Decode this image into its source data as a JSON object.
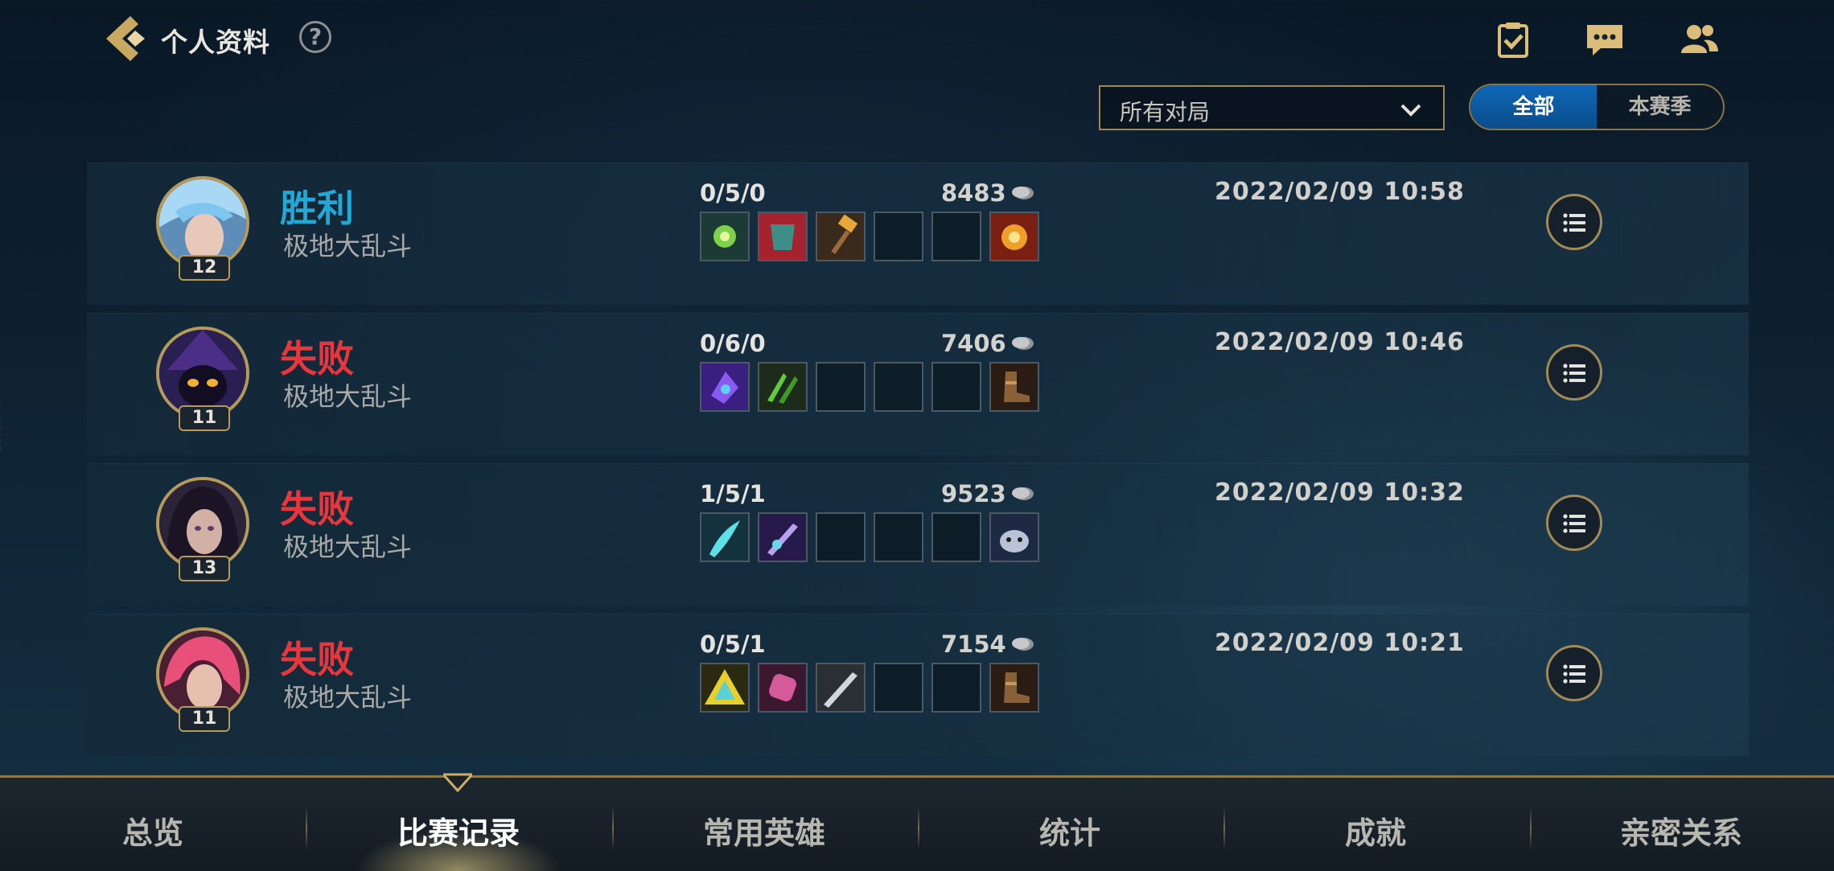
{
  "header": {
    "title": "个人资料",
    "help_label": "?"
  },
  "filters": {
    "match_type": "所有对局",
    "season_toggle": {
      "all": "全部",
      "current": "本赛季",
      "selected": "全部"
    }
  },
  "matches": [
    {
      "result": "胜利",
      "outcome": "win",
      "mode": "极地大乱斗",
      "level": "12",
      "kda": "0/5/0",
      "gold": "8483",
      "date": "2022/02/09 10:58",
      "champion_icon": "blue-haired-champion",
      "items": [
        "green-orb-item",
        "red-mask-item",
        "golden-hammer-item",
        "empty",
        "empty",
        "fire-ward-item"
      ]
    },
    {
      "result": "失败",
      "outcome": "loss",
      "mode": "极地大乱斗",
      "level": "11",
      "kda": "0/6/0",
      "gold": "7406",
      "date": "2022/02/09 10:46",
      "champion_icon": "dark-hat-champion",
      "items": [
        "purple-tome-item",
        "green-claw-item",
        "empty",
        "empty",
        "empty",
        "boots-item"
      ]
    },
    {
      "result": "失败",
      "outcome": "loss",
      "mode": "极地大乱斗",
      "level": "13",
      "kda": "1/5/1",
      "gold": "9523",
      "date": "2022/02/09 10:32",
      "champion_icon": "dark-haired-champion",
      "items": [
        "cyan-blade-item",
        "violet-sword-item",
        "empty",
        "empty",
        "empty",
        "poro-ward-item"
      ]
    },
    {
      "result": "失败",
      "outcome": "loss",
      "mode": "极地大乱斗",
      "level": "11",
      "kda": "0/5/1",
      "gold": "7154",
      "date": "2022/02/09 10:21",
      "champion_icon": "pink-haired-champion",
      "items": [
        "yellow-triangle-item",
        "pink-gauntlet-item",
        "steel-sword-item",
        "empty",
        "empty",
        "boots-item"
      ]
    }
  ],
  "side_id": "2031887",
  "tabs": [
    {
      "label": "总览"
    },
    {
      "label": "比赛记录"
    },
    {
      "label": "常用英雄"
    },
    {
      "label": "统计"
    },
    {
      "label": "成就"
    },
    {
      "label": "亲密关系"
    }
  ],
  "active_tab": "比赛记录",
  "colors": {
    "win": "#1fa9d6",
    "loss": "#e9363d",
    "gold_border": "#b59a5c",
    "toggle_active": "#0f67b6"
  }
}
